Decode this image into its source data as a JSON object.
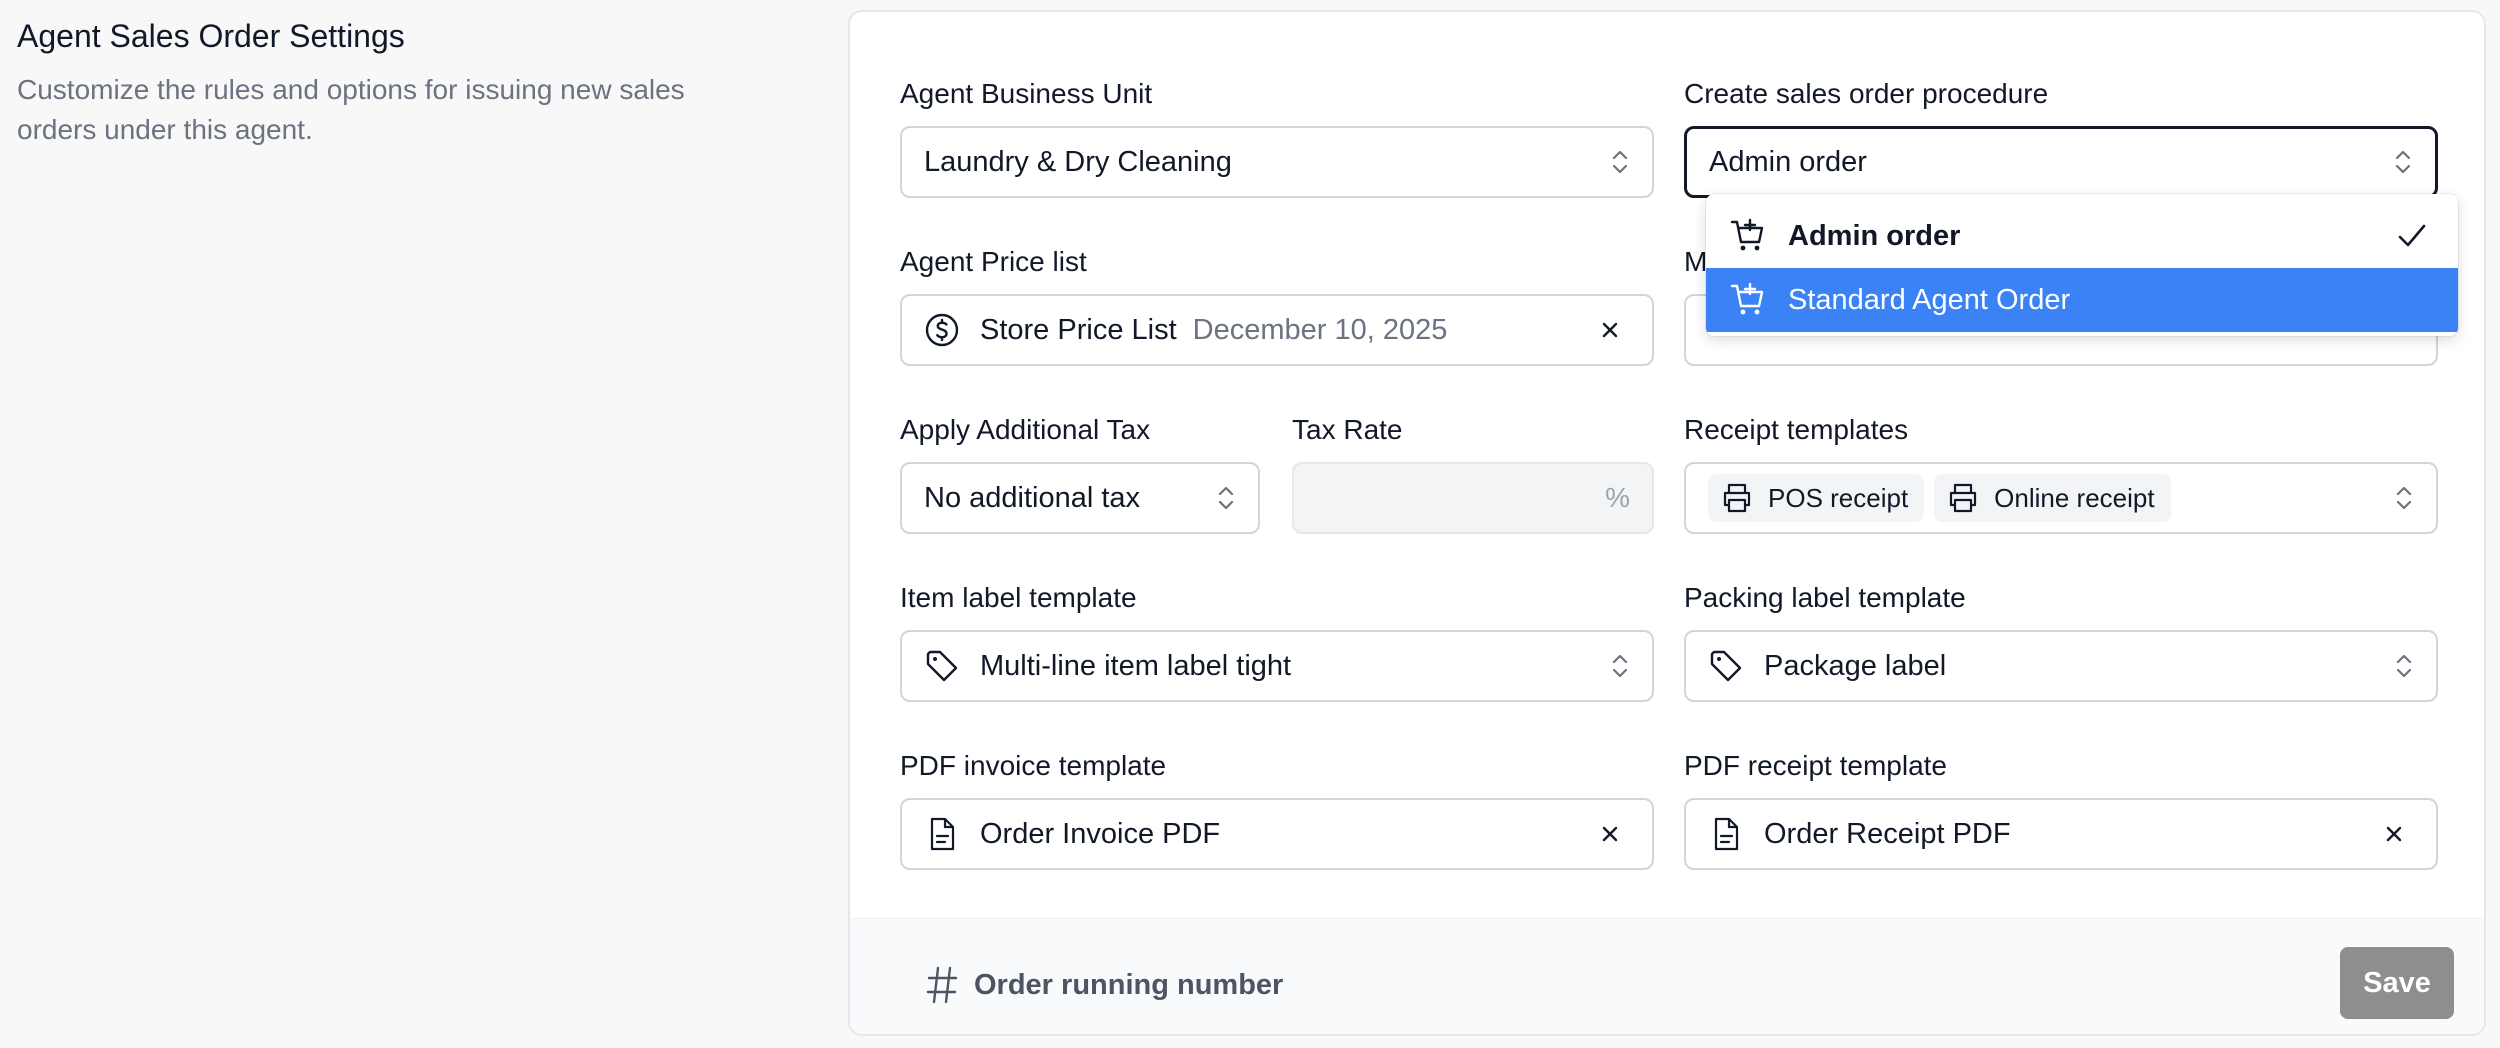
{
  "header": {
    "title": "Agent Sales Order Settings",
    "description": "Customize the rules and options for issuing new sales orders under this agent."
  },
  "form": {
    "business_unit": {
      "label": "Agent Business Unit",
      "value": "Laundry & Dry Cleaning"
    },
    "procedure": {
      "label": "Create sales order procedure",
      "value": "Admin order",
      "options": [
        {
          "label": "Admin order",
          "selected": true,
          "icon": "cart-plus-icon"
        },
        {
          "label": "Standard Agent Order",
          "highlighted": true,
          "icon": "cart-plus-icon"
        }
      ]
    },
    "price_list": {
      "label": "Agent Price list",
      "value": "Store Price List",
      "date": "December 10, 2025",
      "icon": "dollar-circle-icon"
    },
    "hidden_label_fragment": "M",
    "additional_tax": {
      "label": "Apply Additional Tax",
      "value": "No additional tax"
    },
    "tax_rate": {
      "label": "Tax Rate",
      "value": "",
      "unit": "%"
    },
    "receipt_templates": {
      "label": "Receipt templates",
      "chips": [
        {
          "label": "POS receipt",
          "icon": "printer-icon"
        },
        {
          "label": "Online receipt",
          "icon": "printer-icon"
        }
      ]
    },
    "item_label": {
      "label": "Item label template",
      "value": "Multi-line item label tight",
      "icon": "tag-icon"
    },
    "packing_label": {
      "label": "Packing label template",
      "value": "Package label",
      "icon": "tag-icon"
    },
    "pdf_invoice": {
      "label": "PDF invoice template",
      "value": "Order Invoice PDF",
      "icon": "document-icon"
    },
    "pdf_receipt": {
      "label": "PDF receipt template",
      "value": "Order Receipt PDF",
      "icon": "document-icon"
    }
  },
  "footer": {
    "running_number_label": "Order running number",
    "save_label": "Save"
  },
  "colors": {
    "highlight": "#3b82f6",
    "save_button": "#8e8e8e",
    "muted_text": "#6b7280"
  }
}
